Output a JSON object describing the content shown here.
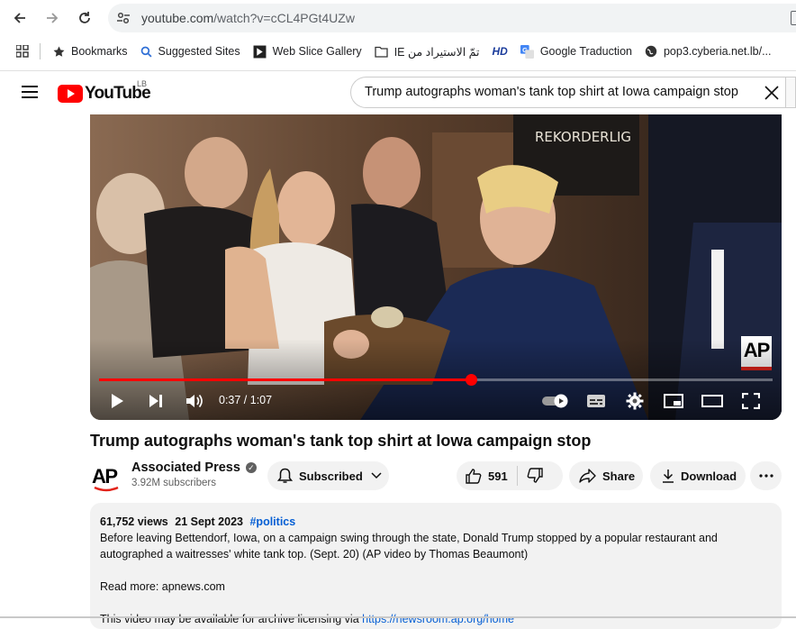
{
  "browser": {
    "url_host": "youtube.com",
    "url_rest": "/watch?v=cCL4PGt4UZw",
    "bookmarks": [
      {
        "label": "Bookmarks",
        "icon": "star-icon"
      },
      {
        "label": "Suggested Sites",
        "icon": "search-icon"
      },
      {
        "label": "Web Slice Gallery",
        "icon": "web-slice-icon"
      },
      {
        "label": "تمّ الاستيراد من IE",
        "icon": "folder-icon"
      },
      {
        "label": "",
        "icon": "hd-icon"
      },
      {
        "label": "Google Traduction",
        "icon": "translate-icon"
      },
      {
        "label": "pop3.cyberia.net.lb/...",
        "icon": "globe-icon"
      }
    ],
    "hd_badge": "HD"
  },
  "youtube": {
    "logo_word": "YouTube",
    "country_code": "LB",
    "search_query": "Trump autographs woman's tank top shirt at Iowa campaign stop"
  },
  "player": {
    "current_time": "0:37",
    "duration": "1:07",
    "time_display": "0:37 / 1:07",
    "progress_fraction": 0.552,
    "watermark": "AP",
    "accent": "#ff0000"
  },
  "video": {
    "title": "Trump autographs woman's tank top shirt at Iowa campaign stop",
    "channel": {
      "name": "Associated Press",
      "subscribers": "3.92M subscribers",
      "logo_text": "AP"
    },
    "actions": {
      "subscribed_label": "Subscribed",
      "likes": "591",
      "share_label": "Share",
      "download_label": "Download"
    }
  },
  "description": {
    "views": "61,752 views",
    "date": "21 Sept 2023",
    "hashtag": "#politics",
    "body_line1": "Before leaving Bettendorf, Iowa, on a campaign swing through the state,  Donald Trump stopped by a popular restaurant and",
    "body_line2": "autographed a waitresses' white tank top. (Sept. 20) (AP video by Thomas Beaumont)",
    "read_more": "Read more: apnews.com",
    "licensing_text": "This video may be available for archive licensing via ",
    "licensing_link": "https://newsroom.ap.org/home"
  }
}
